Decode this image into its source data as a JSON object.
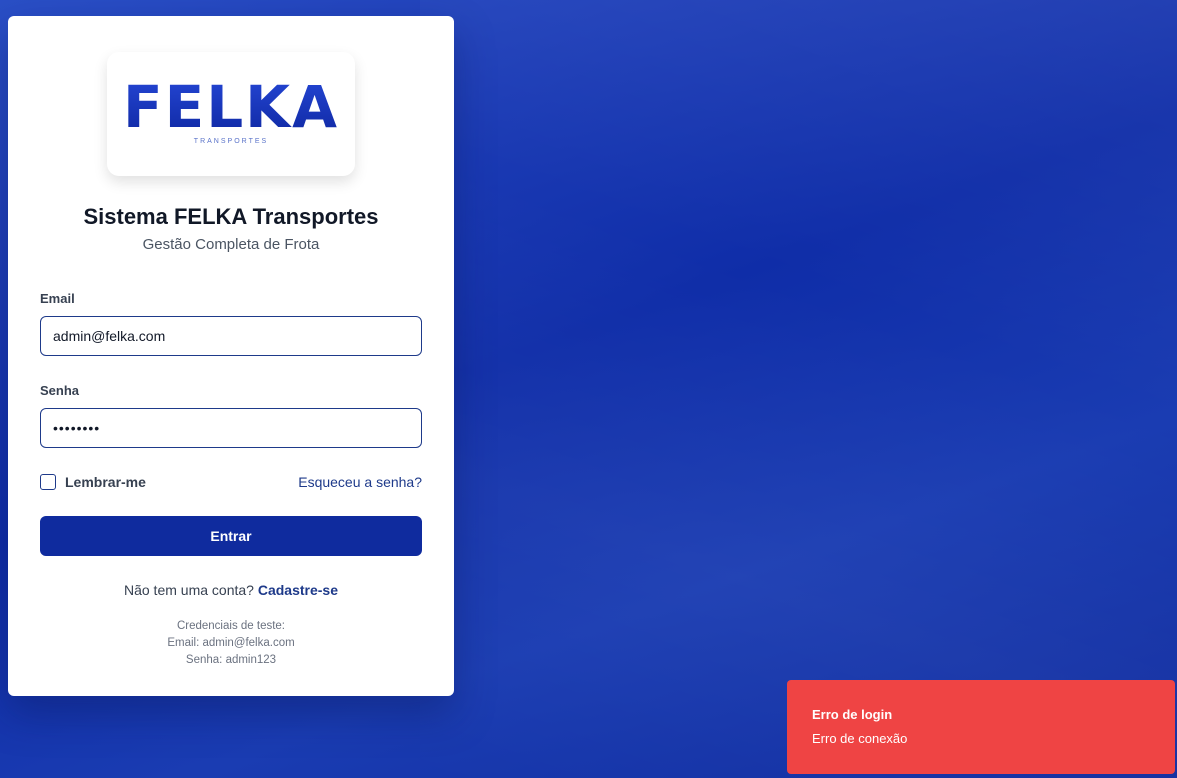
{
  "colors": {
    "primary": "#0f2b9e",
    "link": "#1e3a8a",
    "toast_error": "#ef4444",
    "background": "#1a3cb2"
  },
  "logo": {
    "wordmark": "FELKA",
    "tagline": "TRANSPORTES"
  },
  "header": {
    "title": "Sistema FELKA Transportes",
    "subtitle": "Gestão Completa de Frota"
  },
  "form": {
    "email_label": "Email",
    "email_value": "admin@felka.com",
    "password_label": "Senha",
    "password_value": "••••••••",
    "remember_label": "Lembrar-me",
    "remember_checked": false,
    "forgot_link": "Esqueceu a senha?",
    "submit_label": "Entrar"
  },
  "signup": {
    "prompt": "Não tem uma conta?",
    "link": "Cadastre-se"
  },
  "test_credentials": {
    "heading": "Credenciais de teste:",
    "email_line": "Email: admin@felka.com",
    "password_line": "Senha: admin123"
  },
  "toast": {
    "title": "Erro de login",
    "message": "Erro de conexão"
  }
}
